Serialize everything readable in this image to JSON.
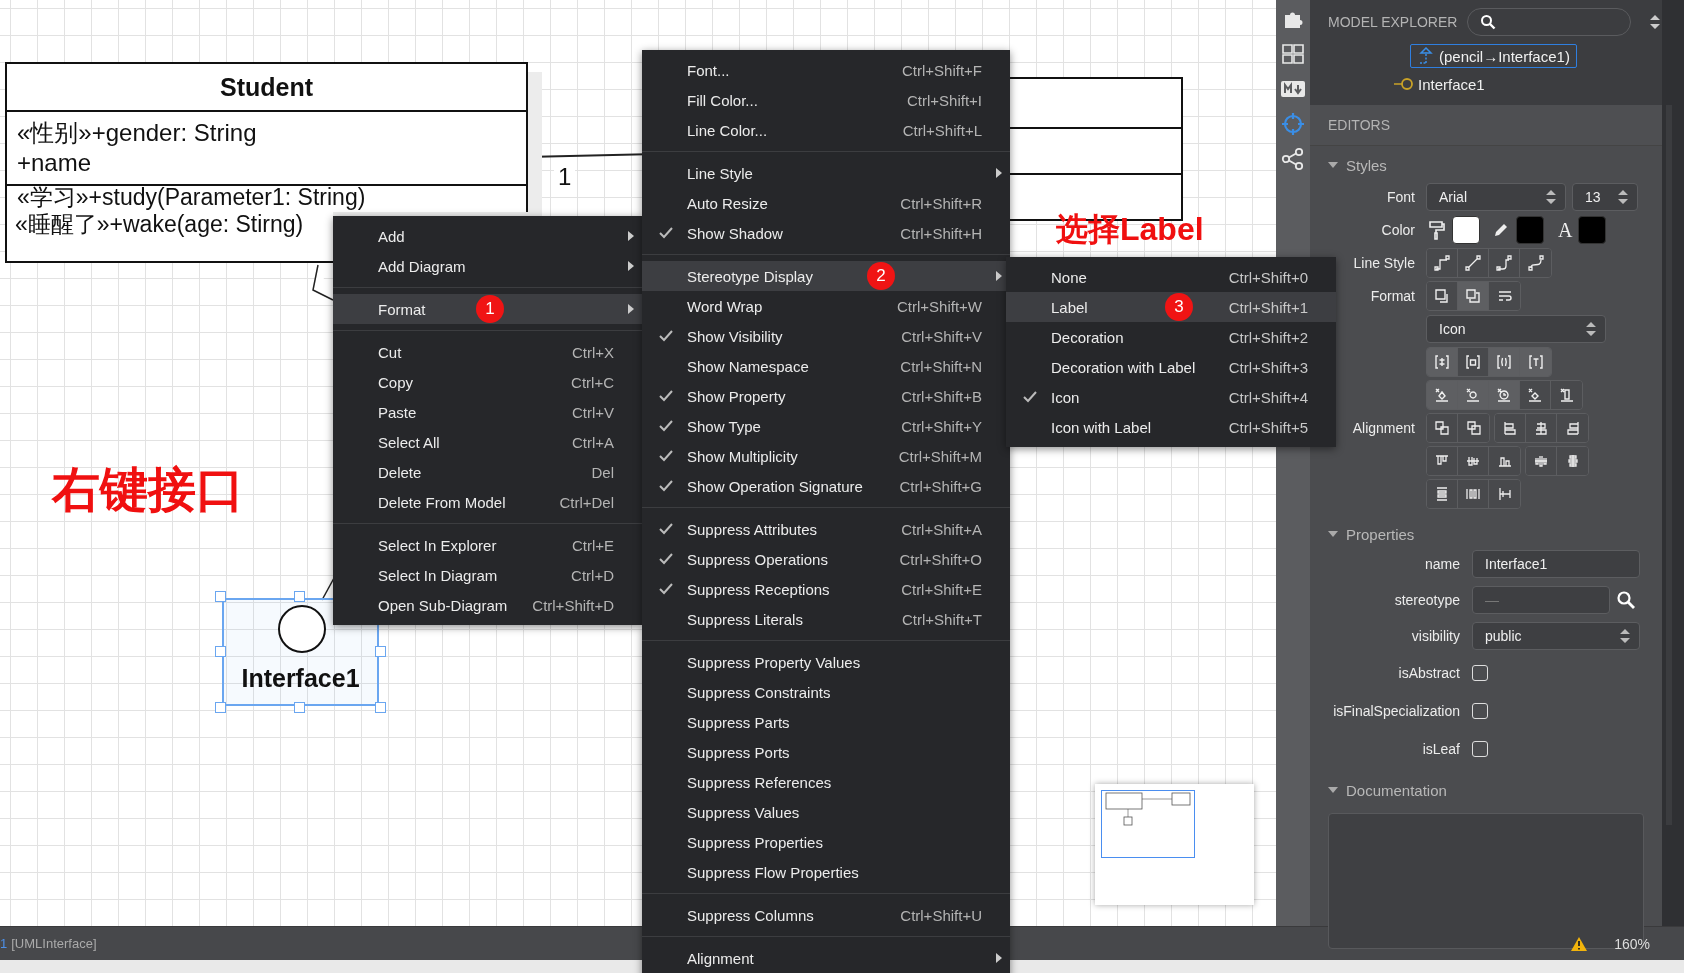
{
  "canvas": {
    "class_box": {
      "name": "Student",
      "attributes": [
        "«性别»+gender: String",
        "+name"
      ],
      "operations": [
        "«学习»+study(Parameter1: String)",
        "«睡醒了»+wake(age: Stirng)"
      ]
    },
    "multiplicity": "1",
    "interface": {
      "name": "Interface1",
      "selected": true
    },
    "notes": [
      "右键接口",
      "选择Label"
    ]
  },
  "context_menu": {
    "items": [
      {
        "kind": "submenu",
        "label": "Add",
        "selected": false
      },
      {
        "kind": "submenu",
        "label": "Add Diagram",
        "selected": false
      },
      {
        "kind": "separator"
      },
      {
        "kind": "submenu",
        "label": "Format",
        "selected": true,
        "badge": "1"
      },
      {
        "kind": "separator"
      },
      {
        "kind": "item",
        "label": "Cut",
        "shortcut": "Ctrl+X",
        "selected": false
      },
      {
        "kind": "item",
        "label": "Copy",
        "shortcut": "Ctrl+C",
        "selected": false
      },
      {
        "kind": "item",
        "label": "Paste",
        "shortcut": "Ctrl+V",
        "selected": false
      },
      {
        "kind": "item",
        "label": "Select All",
        "shortcut": "Ctrl+A",
        "selected": false
      },
      {
        "kind": "item",
        "label": "Delete",
        "shortcut": "Del",
        "selected": false
      },
      {
        "kind": "item",
        "label": "Delete From Model",
        "shortcut": "Ctrl+Del",
        "selected": false
      },
      {
        "kind": "separator"
      },
      {
        "kind": "item",
        "label": "Select In Explorer",
        "shortcut": "Ctrl+E",
        "selected": false
      },
      {
        "kind": "item",
        "label": "Select In Diagram",
        "shortcut": "Ctrl+D",
        "selected": false
      },
      {
        "kind": "item",
        "label": "Open Sub-Diagram",
        "shortcut": "Ctrl+Shift+D",
        "selected": false
      }
    ]
  },
  "format_submenu": {
    "items": [
      {
        "kind": "item",
        "label": "Font...",
        "shortcut": "Ctrl+Shift+F",
        "selected": false,
        "checked": false
      },
      {
        "kind": "item",
        "label": "Fill Color...",
        "shortcut": "Ctrl+Shift+I",
        "selected": false,
        "checked": false
      },
      {
        "kind": "item",
        "label": "Line Color...",
        "shortcut": "Ctrl+Shift+L",
        "selected": false,
        "checked": false
      },
      {
        "kind": "separator"
      },
      {
        "kind": "submenu",
        "label": "Line Style",
        "selected": false,
        "checked": false
      },
      {
        "kind": "item",
        "label": "Auto Resize",
        "shortcut": "Ctrl+Shift+R",
        "selected": false,
        "checked": false
      },
      {
        "kind": "item",
        "label": "Show Shadow",
        "shortcut": "Ctrl+Shift+H",
        "selected": false,
        "checked": true
      },
      {
        "kind": "separator"
      },
      {
        "kind": "submenu",
        "label": "Stereotype Display",
        "selected": true,
        "checked": false,
        "badge": "2"
      },
      {
        "kind": "item",
        "label": "Word Wrap",
        "shortcut": "Ctrl+Shift+W",
        "selected": false,
        "checked": false
      },
      {
        "kind": "item",
        "label": "Show Visibility",
        "shortcut": "Ctrl+Shift+V",
        "selected": false,
        "checked": true
      },
      {
        "kind": "item",
        "label": "Show Namespace",
        "shortcut": "Ctrl+Shift+N",
        "selected": false,
        "checked": false
      },
      {
        "kind": "item",
        "label": "Show Property",
        "shortcut": "Ctrl+Shift+B",
        "selected": false,
        "checked": true
      },
      {
        "kind": "item",
        "label": "Show Type",
        "shortcut": "Ctrl+Shift+Y",
        "selected": false,
        "checked": true
      },
      {
        "kind": "item",
        "label": "Show Multiplicity",
        "shortcut": "Ctrl+Shift+M",
        "selected": false,
        "checked": true
      },
      {
        "kind": "item",
        "label": "Show Operation Signature",
        "shortcut": "Ctrl+Shift+G",
        "selected": false,
        "checked": true
      },
      {
        "kind": "separator"
      },
      {
        "kind": "item",
        "label": "Suppress Attributes",
        "shortcut": "Ctrl+Shift+A",
        "selected": false,
        "checked": true
      },
      {
        "kind": "item",
        "label": "Suppress Operations",
        "shortcut": "Ctrl+Shift+O",
        "selected": false,
        "checked": true
      },
      {
        "kind": "item",
        "label": "Suppress Receptions",
        "shortcut": "Ctrl+Shift+E",
        "selected": false,
        "checked": true
      },
      {
        "kind": "item",
        "label": "Suppress Literals",
        "shortcut": "Ctrl+Shift+T",
        "selected": false,
        "checked": false
      },
      {
        "kind": "separator"
      },
      {
        "kind": "item",
        "label": "Suppress Property Values",
        "selected": false,
        "checked": false
      },
      {
        "kind": "item",
        "label": "Suppress Constraints",
        "selected": false,
        "checked": false
      },
      {
        "kind": "item",
        "label": "Suppress Parts",
        "selected": false,
        "checked": false
      },
      {
        "kind": "item",
        "label": "Suppress Ports",
        "selected": false,
        "checked": false
      },
      {
        "kind": "item",
        "label": "Suppress References",
        "selected": false,
        "checked": false
      },
      {
        "kind": "item",
        "label": "Suppress Values",
        "selected": false,
        "checked": false
      },
      {
        "kind": "item",
        "label": "Suppress Properties",
        "selected": false,
        "checked": false
      },
      {
        "kind": "item",
        "label": "Suppress Flow Properties",
        "selected": false,
        "checked": false
      },
      {
        "kind": "separator"
      },
      {
        "kind": "item",
        "label": "Suppress Columns",
        "shortcut": "Ctrl+Shift+U",
        "selected": false,
        "checked": false
      },
      {
        "kind": "separator"
      },
      {
        "kind": "submenu",
        "label": "Alignment",
        "selected": false,
        "checked": false
      }
    ]
  },
  "stereotype_submenu": {
    "items": [
      {
        "kind": "item",
        "label": "None",
        "shortcut": "Ctrl+Shift+0",
        "selected": false,
        "checked": false
      },
      {
        "kind": "item",
        "label": "Label",
        "shortcut": "Ctrl+Shift+1",
        "selected": true,
        "checked": false,
        "badge": "3"
      },
      {
        "kind": "item",
        "label": "Decoration",
        "shortcut": "Ctrl+Shift+2",
        "selected": false,
        "checked": false
      },
      {
        "kind": "item",
        "label": "Decoration with Label",
        "shortcut": "Ctrl+Shift+3",
        "selected": false,
        "checked": false
      },
      {
        "kind": "item",
        "label": "Icon",
        "shortcut": "Ctrl+Shift+4",
        "selected": false,
        "checked": true
      },
      {
        "kind": "item",
        "label": "Icon with Label",
        "shortcut": "Ctrl+Shift+5",
        "selected": false,
        "checked": false
      }
    ]
  },
  "toolbar": [
    {
      "kind": "extensions",
      "selected": false
    },
    {
      "kind": "layout",
      "selected": false
    },
    {
      "kind": "markdown",
      "selected": false
    },
    {
      "kind": "target",
      "selected": true
    },
    {
      "kind": "share",
      "selected": false
    }
  ],
  "model_explorer": {
    "title": "MODEL EXPLORER",
    "tree": [
      {
        "kind": "realization",
        "label": "(pencil→Interface1)",
        "selected": true
      },
      {
        "kind": "interface",
        "label": "Interface1",
        "selected": false
      }
    ]
  },
  "editors": {
    "title": "EDITORS",
    "styles": {
      "title": "Styles",
      "expanded": true,
      "font": {
        "label": "Font",
        "family": "Arial",
        "size": "13"
      },
      "color": {
        "label": "Color",
        "swatches": [
          {
            "kind": "fill",
            "color": "#ffffff"
          },
          {
            "kind": "line",
            "color": "#000000"
          },
          {
            "kind": "text",
            "icon": "A",
            "color": "#000000"
          }
        ]
      },
      "line_style": {
        "label": "Line Style"
      },
      "format": {
        "label": "Format",
        "buttons": [
          {
            "kind": "auto-resize",
            "selected": false
          },
          {
            "kind": "shadow",
            "selected": true
          },
          {
            "kind": "word-wrap",
            "selected": false
          }
        ],
        "stereotype_display": "Icon",
        "toggles": [
          [
            {
              "kind": "visibility",
              "on": true
            },
            {
              "kind": "namespace",
              "on": false
            },
            {
              "kind": "property",
              "on": true
            },
            {
              "kind": "type",
              "on": true
            }
          ],
          [
            {
              "kind": "attributes",
              "on": true
            },
            {
              "kind": "operations",
              "on": true
            },
            {
              "kind": "receptions",
              "on": true
            },
            {
              "kind": "literals",
              "on": false
            },
            {
              "kind": "columns",
              "on": false
            }
          ]
        ]
      },
      "alignment": {
        "label": "Alignment"
      }
    },
    "properties": {
      "title": "Properties",
      "expanded": true,
      "fields": [
        {
          "kind": "text",
          "label": "name",
          "value": "Interface1"
        },
        {
          "kind": "search",
          "label": "stereotype",
          "placeholder": "—"
        },
        {
          "kind": "select",
          "label": "visibility",
          "value": "public"
        },
        {
          "kind": "checkbox",
          "label": "isAbstract",
          "checked": false
        },
        {
          "kind": "checkbox",
          "label": "isFinalSpecialization",
          "checked": false
        },
        {
          "kind": "checkbox",
          "label": "isLeaf",
          "checked": false
        }
      ]
    },
    "documentation": {
      "title": "Documentation",
      "expanded": true
    }
  },
  "status_bar": {
    "index": "1",
    "element": "[UMLInterface]",
    "zoom": "160%"
  }
}
